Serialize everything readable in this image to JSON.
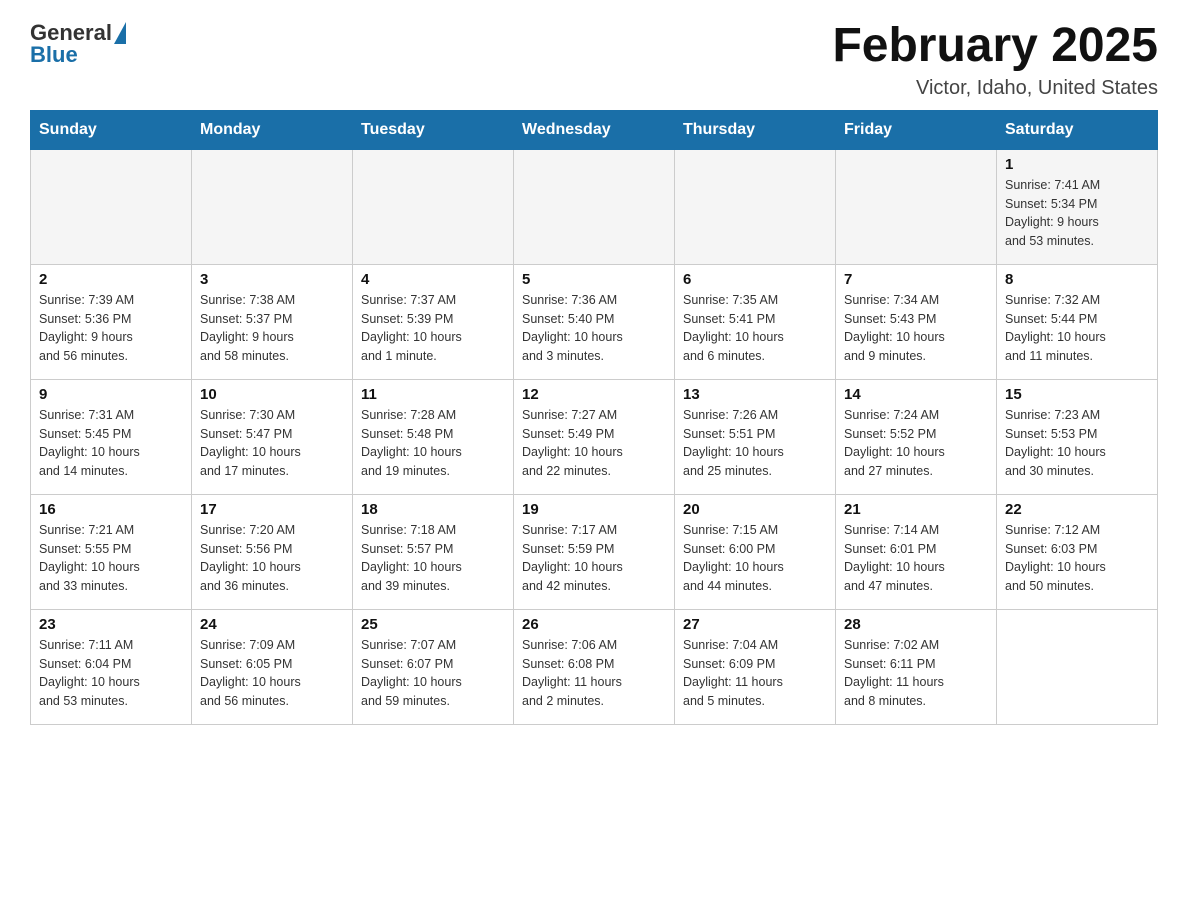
{
  "logo": {
    "general": "General",
    "blue": "Blue"
  },
  "header": {
    "month": "February 2025",
    "location": "Victor, Idaho, United States"
  },
  "days_of_week": [
    "Sunday",
    "Monday",
    "Tuesday",
    "Wednesday",
    "Thursday",
    "Friday",
    "Saturday"
  ],
  "weeks": [
    [
      {
        "day": "",
        "info": ""
      },
      {
        "day": "",
        "info": ""
      },
      {
        "day": "",
        "info": ""
      },
      {
        "day": "",
        "info": ""
      },
      {
        "day": "",
        "info": ""
      },
      {
        "day": "",
        "info": ""
      },
      {
        "day": "1",
        "info": "Sunrise: 7:41 AM\nSunset: 5:34 PM\nDaylight: 9 hours\nand 53 minutes."
      }
    ],
    [
      {
        "day": "2",
        "info": "Sunrise: 7:39 AM\nSunset: 5:36 PM\nDaylight: 9 hours\nand 56 minutes."
      },
      {
        "day": "3",
        "info": "Sunrise: 7:38 AM\nSunset: 5:37 PM\nDaylight: 9 hours\nand 58 minutes."
      },
      {
        "day": "4",
        "info": "Sunrise: 7:37 AM\nSunset: 5:39 PM\nDaylight: 10 hours\nand 1 minute."
      },
      {
        "day": "5",
        "info": "Sunrise: 7:36 AM\nSunset: 5:40 PM\nDaylight: 10 hours\nand 3 minutes."
      },
      {
        "day": "6",
        "info": "Sunrise: 7:35 AM\nSunset: 5:41 PM\nDaylight: 10 hours\nand 6 minutes."
      },
      {
        "day": "7",
        "info": "Sunrise: 7:34 AM\nSunset: 5:43 PM\nDaylight: 10 hours\nand 9 minutes."
      },
      {
        "day": "8",
        "info": "Sunrise: 7:32 AM\nSunset: 5:44 PM\nDaylight: 10 hours\nand 11 minutes."
      }
    ],
    [
      {
        "day": "9",
        "info": "Sunrise: 7:31 AM\nSunset: 5:45 PM\nDaylight: 10 hours\nand 14 minutes."
      },
      {
        "day": "10",
        "info": "Sunrise: 7:30 AM\nSunset: 5:47 PM\nDaylight: 10 hours\nand 17 minutes."
      },
      {
        "day": "11",
        "info": "Sunrise: 7:28 AM\nSunset: 5:48 PM\nDaylight: 10 hours\nand 19 minutes."
      },
      {
        "day": "12",
        "info": "Sunrise: 7:27 AM\nSunset: 5:49 PM\nDaylight: 10 hours\nand 22 minutes."
      },
      {
        "day": "13",
        "info": "Sunrise: 7:26 AM\nSunset: 5:51 PM\nDaylight: 10 hours\nand 25 minutes."
      },
      {
        "day": "14",
        "info": "Sunrise: 7:24 AM\nSunset: 5:52 PM\nDaylight: 10 hours\nand 27 minutes."
      },
      {
        "day": "15",
        "info": "Sunrise: 7:23 AM\nSunset: 5:53 PM\nDaylight: 10 hours\nand 30 minutes."
      }
    ],
    [
      {
        "day": "16",
        "info": "Sunrise: 7:21 AM\nSunset: 5:55 PM\nDaylight: 10 hours\nand 33 minutes."
      },
      {
        "day": "17",
        "info": "Sunrise: 7:20 AM\nSunset: 5:56 PM\nDaylight: 10 hours\nand 36 minutes."
      },
      {
        "day": "18",
        "info": "Sunrise: 7:18 AM\nSunset: 5:57 PM\nDaylight: 10 hours\nand 39 minutes."
      },
      {
        "day": "19",
        "info": "Sunrise: 7:17 AM\nSunset: 5:59 PM\nDaylight: 10 hours\nand 42 minutes."
      },
      {
        "day": "20",
        "info": "Sunrise: 7:15 AM\nSunset: 6:00 PM\nDaylight: 10 hours\nand 44 minutes."
      },
      {
        "day": "21",
        "info": "Sunrise: 7:14 AM\nSunset: 6:01 PM\nDaylight: 10 hours\nand 47 minutes."
      },
      {
        "day": "22",
        "info": "Sunrise: 7:12 AM\nSunset: 6:03 PM\nDaylight: 10 hours\nand 50 minutes."
      }
    ],
    [
      {
        "day": "23",
        "info": "Sunrise: 7:11 AM\nSunset: 6:04 PM\nDaylight: 10 hours\nand 53 minutes."
      },
      {
        "day": "24",
        "info": "Sunrise: 7:09 AM\nSunset: 6:05 PM\nDaylight: 10 hours\nand 56 minutes."
      },
      {
        "day": "25",
        "info": "Sunrise: 7:07 AM\nSunset: 6:07 PM\nDaylight: 10 hours\nand 59 minutes."
      },
      {
        "day": "26",
        "info": "Sunrise: 7:06 AM\nSunset: 6:08 PM\nDaylight: 11 hours\nand 2 minutes."
      },
      {
        "day": "27",
        "info": "Sunrise: 7:04 AM\nSunset: 6:09 PM\nDaylight: 11 hours\nand 5 minutes."
      },
      {
        "day": "28",
        "info": "Sunrise: 7:02 AM\nSunset: 6:11 PM\nDaylight: 11 hours\nand 8 minutes."
      },
      {
        "day": "",
        "info": ""
      }
    ]
  ]
}
